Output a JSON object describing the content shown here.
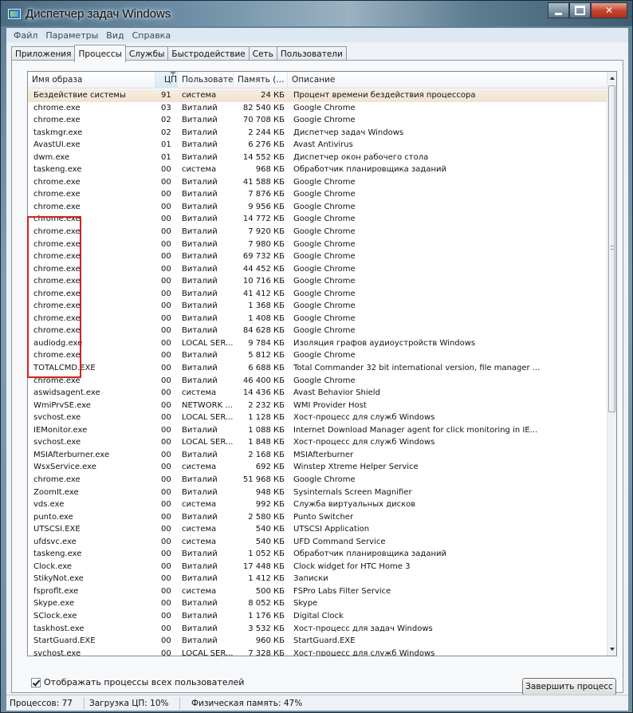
{
  "window": {
    "title": "Диспетчер задач Windows"
  },
  "menu": [
    "Файл",
    "Параметры",
    "Вид",
    "Справка"
  ],
  "tabs": [
    {
      "label": "Приложения",
      "active": false
    },
    {
      "label": "Процессы",
      "active": true
    },
    {
      "label": "Службы",
      "active": false
    },
    {
      "label": "Быстродействие",
      "active": false
    },
    {
      "label": "Сеть",
      "active": false
    },
    {
      "label": "Пользователи",
      "active": false
    }
  ],
  "columns": {
    "name": "Имя образа",
    "cpu": "ЦП",
    "user": "Пользователь",
    "mem": "Память (...",
    "desc": "Описание"
  },
  "processes": [
    [
      "Бездействие системы",
      "91",
      "система",
      "24 КБ",
      "Процент времени бездействия процессора"
    ],
    [
      "chrome.exe",
      "03",
      "Виталий",
      "82 540 КБ",
      "Google Chrome"
    ],
    [
      "chrome.exe",
      "02",
      "Виталий",
      "70 708 КБ",
      "Google Chrome"
    ],
    [
      "taskmgr.exe",
      "02",
      "Виталий",
      "2 244 КБ",
      "Диспетчер задач Windows"
    ],
    [
      "AvastUI.exe",
      "01",
      "Виталий",
      "6 276 КБ",
      "Avast Antivirus"
    ],
    [
      "dwm.exe",
      "01",
      "Виталий",
      "14 552 КБ",
      "Диспетчер окон рабочего стола"
    ],
    [
      "taskeng.exe",
      "00",
      "система",
      "968 КБ",
      "Обработчик планировщика заданий"
    ],
    [
      "chrome.exe",
      "00",
      "Виталий",
      "41 588 КБ",
      "Google Chrome"
    ],
    [
      "chrome.exe",
      "00",
      "Виталий",
      "7 876 КБ",
      "Google Chrome"
    ],
    [
      "chrome.exe",
      "00",
      "Виталий",
      "9 956 КБ",
      "Google Chrome"
    ],
    [
      "chrome.exe",
      "00",
      "Виталий",
      "14 772 КБ",
      "Google Chrome"
    ],
    [
      "chrome.exe",
      "00",
      "Виталий",
      "7 920 КБ",
      "Google Chrome"
    ],
    [
      "chrome.exe",
      "00",
      "Виталий",
      "7 980 КБ",
      "Google Chrome"
    ],
    [
      "chrome.exe",
      "00",
      "Виталий",
      "69 732 КБ",
      "Google Chrome"
    ],
    [
      "chrome.exe",
      "00",
      "Виталий",
      "44 452 КБ",
      "Google Chrome"
    ],
    [
      "chrome.exe",
      "00",
      "Виталий",
      "10 716 КБ",
      "Google Chrome"
    ],
    [
      "chrome.exe",
      "00",
      "Виталий",
      "41 412 КБ",
      "Google Chrome"
    ],
    [
      "chrome.exe",
      "00",
      "Виталий",
      "1 368 КБ",
      "Google Chrome"
    ],
    [
      "chrome.exe",
      "00",
      "Виталий",
      "1 408 КБ",
      "Google Chrome"
    ],
    [
      "chrome.exe",
      "00",
      "Виталий",
      "84 628 КБ",
      "Google Chrome"
    ],
    [
      "audiodg.exe",
      "00",
      "LOCAL SER...",
      "9 784 КБ",
      "Изоляция графов аудиоустройств Windows"
    ],
    [
      "chrome.exe",
      "00",
      "Виталий",
      "5 812 КБ",
      "Google Chrome"
    ],
    [
      "TOTALCMD.EXE",
      "00",
      "Виталий",
      "6 688 КБ",
      "Total Commander 32 bit international version, file manager ..."
    ],
    [
      "chrome.exe",
      "00",
      "Виталий",
      "46 400 КБ",
      "Google Chrome"
    ],
    [
      "aswidsagent.exe",
      "00",
      "система",
      "14 436 КБ",
      "Avast Behavior Shield"
    ],
    [
      "WmiPrvSE.exe",
      "00",
      "NETWORK ...",
      "2 232 КБ",
      "WMI Provider Host"
    ],
    [
      "svchost.exe",
      "00",
      "LOCAL SER...",
      "1 128 КБ",
      "Хост-процесс для служб Windows"
    ],
    [
      "IEMonitor.exe",
      "00",
      "Виталий",
      "1 088 КБ",
      "Internet Download Manager agent for click monitoring in IE..."
    ],
    [
      "svchost.exe",
      "00",
      "LOCAL SER...",
      "1 848 КБ",
      "Хост-процесс для служб Windows"
    ],
    [
      "MSIAfterburner.exe",
      "00",
      "Виталий",
      "2 168 КБ",
      "MSIAfterburner"
    ],
    [
      "WsxService.exe",
      "00",
      "система",
      "692 КБ",
      "Winstep Xtreme Helper Service"
    ],
    [
      "chrome.exe",
      "00",
      "Виталий",
      "51 968 КБ",
      "Google Chrome"
    ],
    [
      "ZoomIt.exe",
      "00",
      "Виталий",
      "948 КБ",
      "Sysinternals Screen Magnifier"
    ],
    [
      "vds.exe",
      "00",
      "система",
      "992 КБ",
      "Служба виртуальных дисков"
    ],
    [
      "punto.exe",
      "00",
      "Виталий",
      "2 580 КБ",
      "Punto Switcher"
    ],
    [
      "UTSCSI.EXE",
      "00",
      "система",
      "540 КБ",
      "UTSCSI Application"
    ],
    [
      "ufdsvc.exe",
      "00",
      "система",
      "540 КБ",
      "UFD Command Service"
    ],
    [
      "taskeng.exe",
      "00",
      "Виталий",
      "1 052 КБ",
      "Обработчик планировщика заданий"
    ],
    [
      "Clock.exe",
      "00",
      "Виталий",
      "17 448 КБ",
      "Clock widget for HTC Home 3"
    ],
    [
      "StikyNot.exe",
      "00",
      "Виталий",
      "1 412 КБ",
      "Записки"
    ],
    [
      "fsproflt.exe",
      "00",
      "система",
      "500 КБ",
      "FSPro Labs Filter Service"
    ],
    [
      "Skype.exe",
      "00",
      "Виталий",
      "8 052 КБ",
      "Skype"
    ],
    [
      "SClock.exe",
      "00",
      "Виталий",
      "1 176 КБ",
      "Digital Clock"
    ],
    [
      "taskhost.exe",
      "00",
      "Виталий",
      "3 532 КБ",
      "Хост-процесс для задач Windows"
    ],
    [
      "StartGuard.EXE",
      "00",
      "Виталий",
      "960 КБ",
      "StartGuard.EXE"
    ],
    [
      "svchost.exe",
      "00",
      "LOCAL SER...",
      "7 328 КБ",
      "Хост-процесс для служб Windows"
    ]
  ],
  "show_all": {
    "label": "Отображать процессы всех пользователей",
    "checked": true
  },
  "end_process_label": "Завершить процесс",
  "status": {
    "processes": "Процессов: 77",
    "cpu": "Загрузка ЦП: 10%",
    "memory": "Физическая память: 47%"
  }
}
